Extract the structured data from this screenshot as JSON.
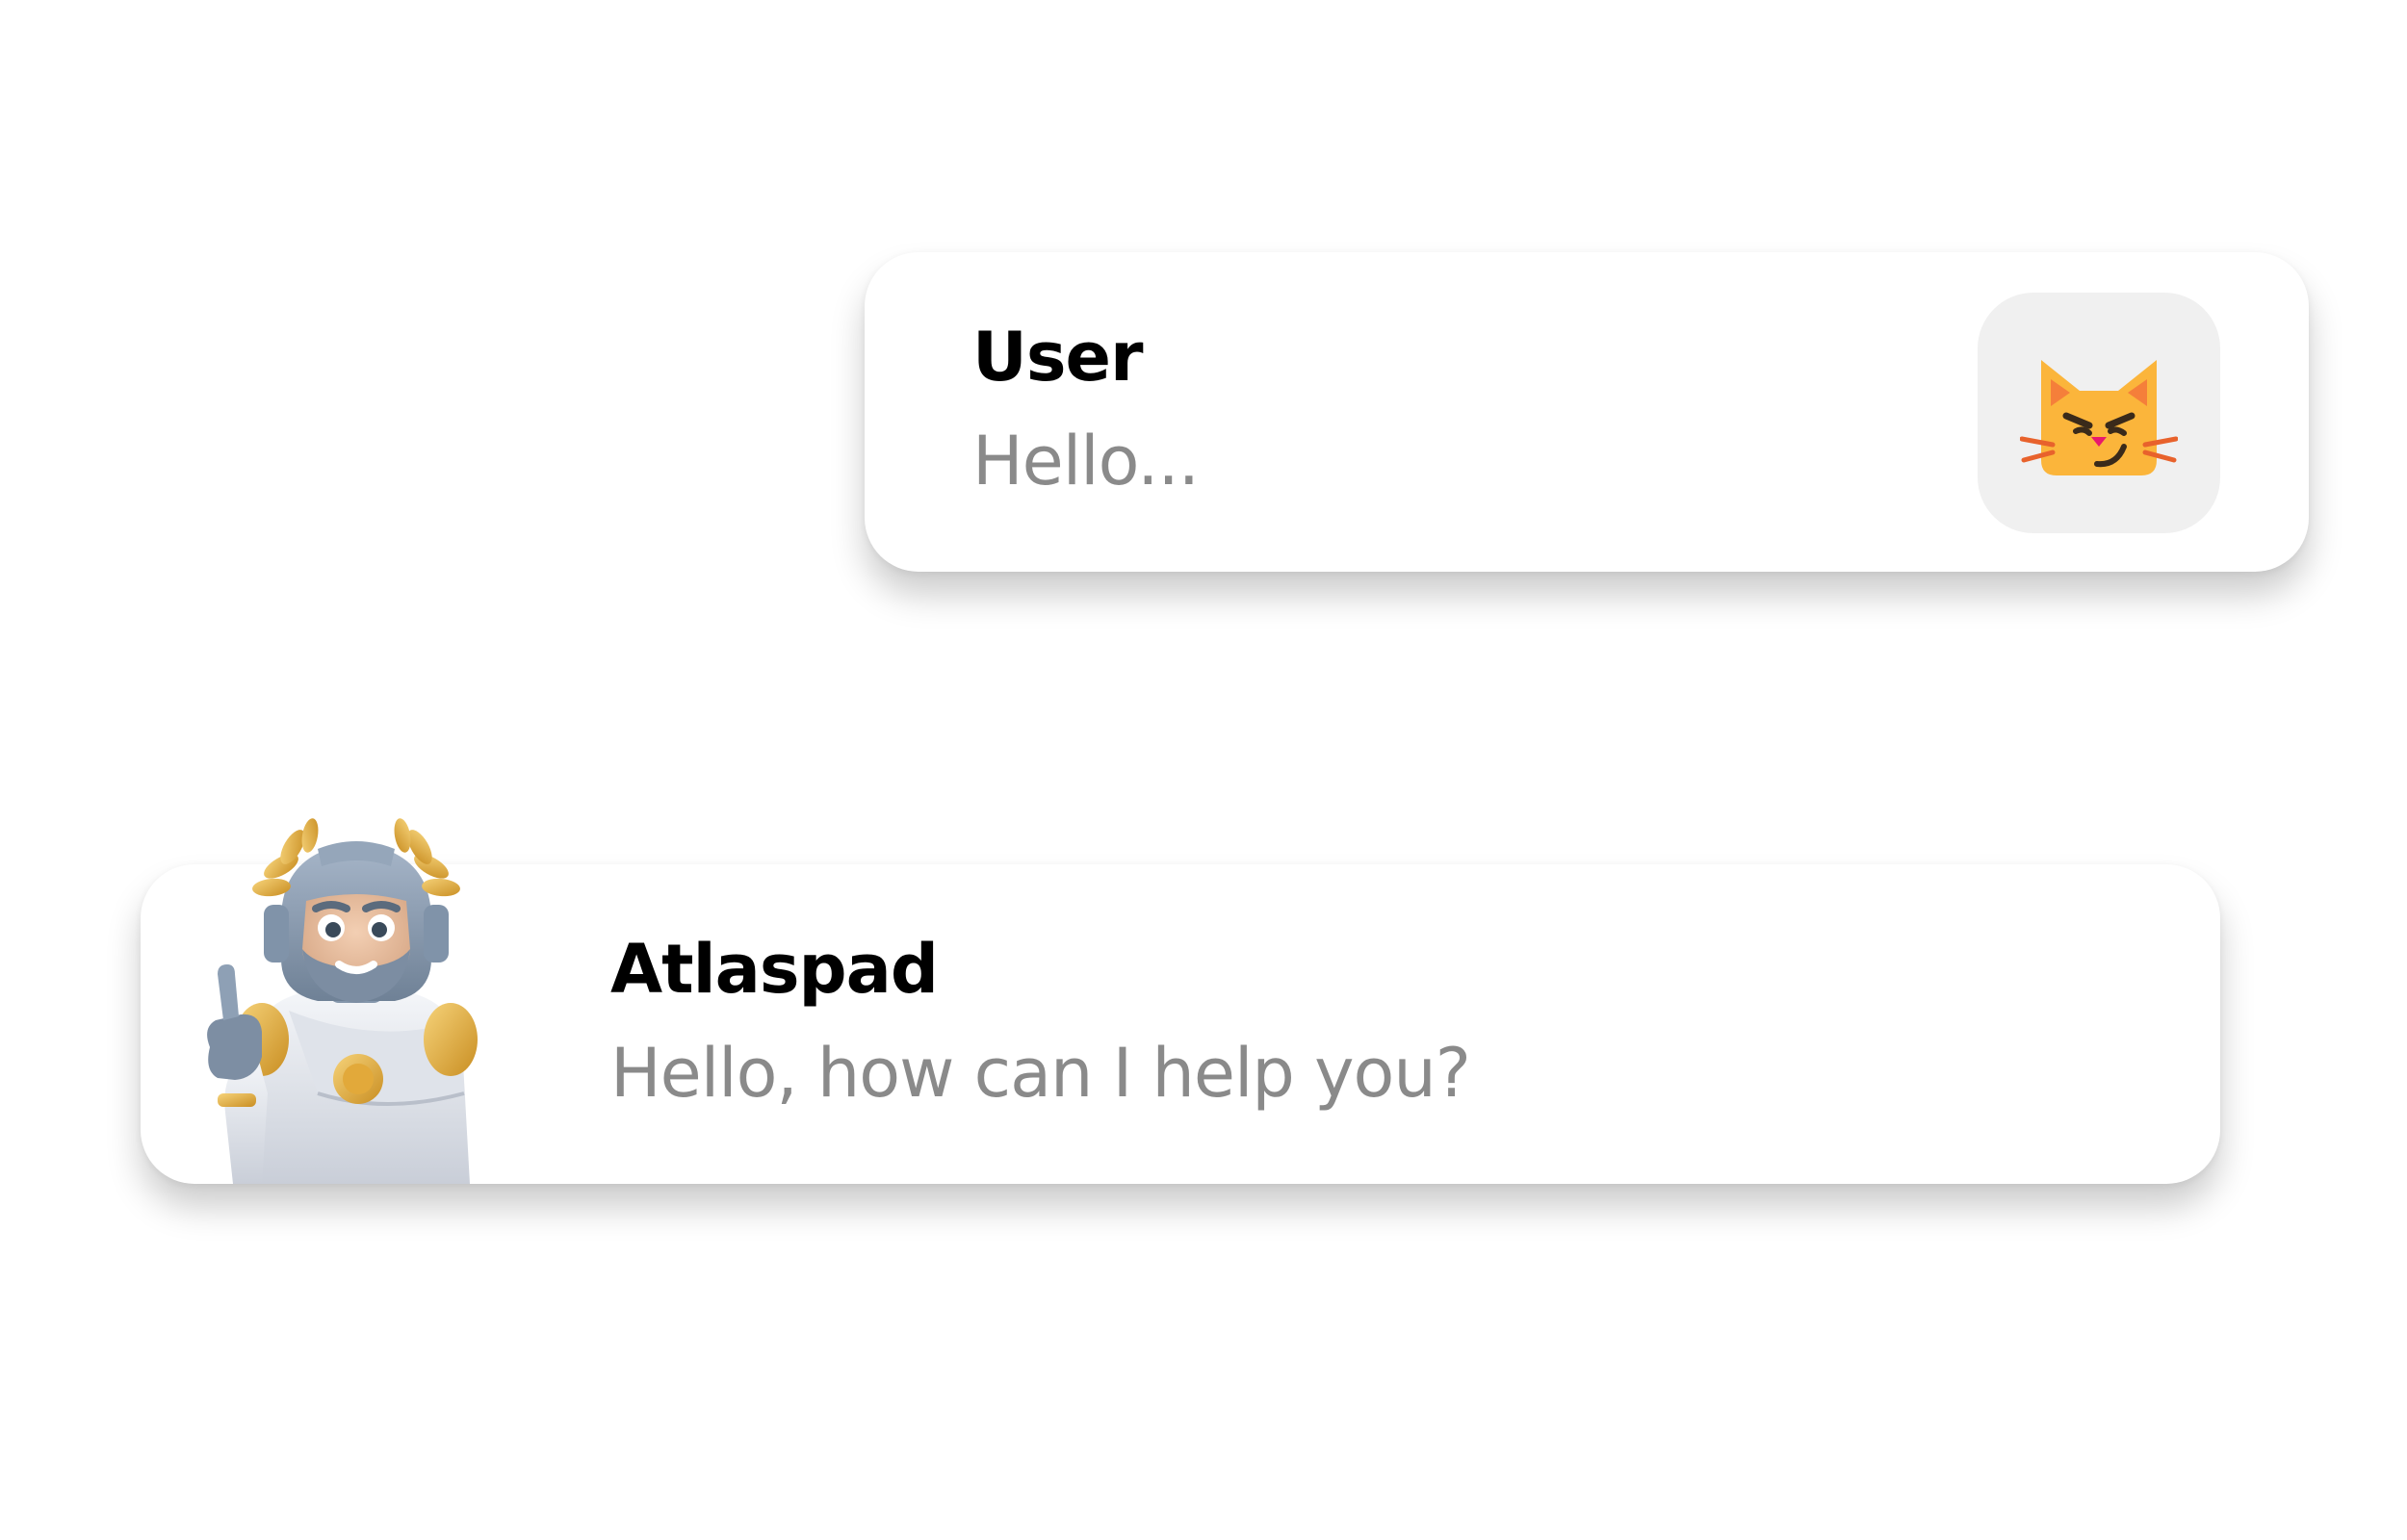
{
  "messages": [
    {
      "role": "user",
      "name": "User",
      "text": "Hello...",
      "avatar_icon": "smirking-cat-emoji-icon",
      "avatar_bg": "#f0f0f0"
    },
    {
      "role": "assistant",
      "name": "Atlaspad",
      "text": "Hello, how can I help you?",
      "avatar_icon": "roman-robot-mascot-icon"
    }
  ],
  "colors": {
    "background": "#ffffff",
    "card": "#ffffff",
    "name_text": "#000000",
    "message_text": "#8a8a8a",
    "cat_face": "#fbb53b",
    "cat_ear_inner": "#f57f3a",
    "cat_nose": "#e8186d",
    "cat_whiskers": "#e8622c"
  }
}
